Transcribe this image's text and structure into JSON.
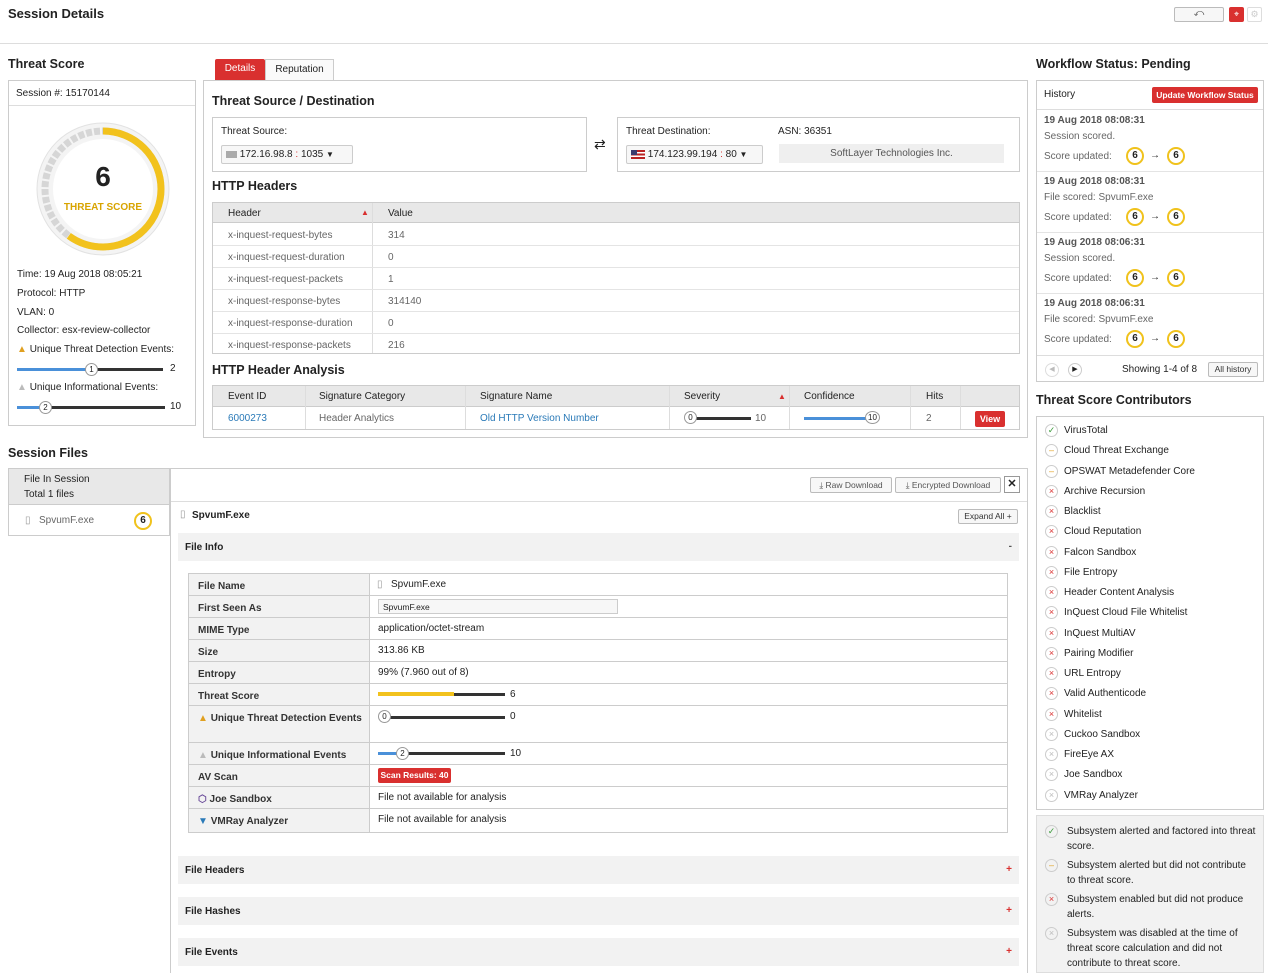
{
  "page_title": "Session Details",
  "header_buttons": {
    "back_icon": "undo-icon",
    "alert_icon": "target-icon",
    "settings_icon": "gear-icon"
  },
  "threat_score": {
    "title": "Threat Score",
    "session_label": "Session #: 15170144",
    "score": "6",
    "score_label": "THREAT SCORE",
    "time": "Time: 19 Aug 2018 08:05:21",
    "protocol": "Protocol: HTTP",
    "vlan": "VLAN: 0",
    "collector": "Collector: esx-review-collector",
    "unique_threat_label": "Unique Threat Detection Events:",
    "unique_threat_value": "1",
    "unique_threat_max": "2",
    "unique_threat_fraction": 0.5,
    "unique_info_label": "Unique Informational Events:",
    "unique_info_value": "2",
    "unique_info_max": "10",
    "unique_info_fraction": 0.2
  },
  "tabs": {
    "details": "Details",
    "reputation": "Reputation"
  },
  "threat_source_dest": {
    "title": "Threat Source / Destination",
    "source_label": "Threat Source:",
    "source_ip": "172.16.98.8",
    "source_port": "1035",
    "dest_label": "Threat Destination:",
    "dest_ip": "174.123.99.194",
    "dest_port": "80",
    "asn_label": "ASN: 36351",
    "asn_org": "SoftLayer Technologies Inc.",
    "swap_icon": "swap-arrows-icon"
  },
  "http_headers": {
    "title": "HTTP Headers",
    "columns": [
      "Header",
      "Value"
    ],
    "rows": [
      [
        "x-inquest-request-bytes",
        "314"
      ],
      [
        "x-inquest-request-duration",
        "0"
      ],
      [
        "x-inquest-request-packets",
        "1"
      ],
      [
        "x-inquest-response-bytes",
        "314140"
      ],
      [
        "x-inquest-response-duration",
        "0"
      ],
      [
        "x-inquest-response-packets",
        "216"
      ]
    ]
  },
  "http_analysis": {
    "title": "HTTP Header Analysis",
    "columns": [
      "Event ID",
      "Signature Category",
      "Signature Name",
      "Severity",
      "Confidence",
      "Hits"
    ],
    "row": {
      "event_id": "6000273",
      "category": "Header Analytics",
      "name": "Old HTTP Version Number",
      "severity_value": "0",
      "severity_max": "10",
      "confidence_value": "10",
      "hits": "2",
      "view": "View"
    }
  },
  "workflow": {
    "title": "Workflow Status: Pending",
    "history_label": "History",
    "update_button": "Update Workflow Status",
    "entries": [
      {
        "time": "19 Aug 2018 08:08:31",
        "text": "Session scored.",
        "score_label": "Score updated:",
        "from": "6",
        "to": "6"
      },
      {
        "time": "19 Aug 2018 08:08:31",
        "text": "File scored: SpvumF.exe",
        "score_label": "Score updated:",
        "from": "6",
        "to": "6"
      },
      {
        "time": "19 Aug 2018 08:06:31",
        "text": "Session scored.",
        "score_label": "Score updated:",
        "from": "6",
        "to": "6"
      },
      {
        "time": "19 Aug 2018 08:06:31",
        "text": "File scored: SpvumF.exe",
        "score_label": "Score updated:",
        "from": "6",
        "to": "6"
      }
    ],
    "showing": "Showing 1-4 of 8",
    "all_history": "All history"
  },
  "contributors": {
    "title": "Threat Score Contributors",
    "items": [
      {
        "name": "VirusTotal",
        "status": "ok"
      },
      {
        "name": "Cloud Threat Exchange",
        "status": "warn"
      },
      {
        "name": "OPSWAT Metadefender Core",
        "status": "warn"
      },
      {
        "name": "Archive Recursion",
        "status": "bad"
      },
      {
        "name": "Blacklist",
        "status": "bad"
      },
      {
        "name": "Cloud Reputation",
        "status": "bad"
      },
      {
        "name": "Falcon Sandbox",
        "status": "bad"
      },
      {
        "name": "File Entropy",
        "status": "bad"
      },
      {
        "name": "Header Content Analysis",
        "status": "bad"
      },
      {
        "name": "InQuest Cloud File Whitelist",
        "status": "bad"
      },
      {
        "name": "InQuest MultiAV",
        "status": "bad"
      },
      {
        "name": "Pairing Modifier",
        "status": "bad"
      },
      {
        "name": "URL Entropy",
        "status": "bad"
      },
      {
        "name": "Valid Authenticode",
        "status": "bad"
      },
      {
        "name": "Whitelist",
        "status": "bad"
      },
      {
        "name": "Cuckoo Sandbox",
        "status": "dis"
      },
      {
        "name": "FireEye AX",
        "status": "dis"
      },
      {
        "name": "Joe Sandbox",
        "status": "dis"
      },
      {
        "name": "VMRay Analyzer",
        "status": "dis"
      }
    ],
    "legend": [
      {
        "status": "ok",
        "text": "Subsystem alerted and factored into threat score."
      },
      {
        "status": "warn",
        "text": "Subsystem alerted but did not contribute to threat score."
      },
      {
        "status": "bad",
        "text": "Subsystem enabled but did not produce alerts."
      },
      {
        "status": "dis",
        "text": "Subsystem was disabled at the time of threat score calculation and did not contribute to threat score."
      }
    ]
  },
  "session_files": {
    "title": "Session Files",
    "list_header": "File In Session",
    "list_sub": "Total 1 files",
    "file_name": "SpvumF.exe",
    "file_score": "6",
    "raw_download": "Raw Download",
    "encrypted_download": "Encrypted Download",
    "expand_all": "Expand All",
    "file_info_label": "File Info",
    "collapse_symbol": "-",
    "info": {
      "file_name_label": "File Name",
      "file_name_value": "SpvumF.exe",
      "first_seen_label": "First Seen As",
      "first_seen_value": "SpvumF.exe",
      "mime_label": "MIME Type",
      "mime_value": "application/octet-stream",
      "size_label": "Size",
      "size_value": "313.86 KB",
      "entropy_label": "Entropy",
      "entropy_value": "99% (7.960 out of 8)",
      "threat_score_label": "Threat Score",
      "threat_score_value": "6",
      "threat_score_fraction": 0.6,
      "ute_label": "Unique Threat Detection Events",
      "ute_value": "0",
      "ute_max": "0",
      "uie_label": "Unique Informational Events",
      "uie_value": "2",
      "uie_max": "10",
      "av_label": "AV Scan",
      "av_value": "Scan Results: 40",
      "joe_label": "Joe Sandbox",
      "joe_value": "File not available for analysis",
      "vmray_label": "VMRay Analyzer",
      "vmray_value": "File not available for analysis"
    },
    "sections": [
      "File Headers",
      "File Hashes",
      "File Events"
    ],
    "expand_symbol": "+"
  }
}
